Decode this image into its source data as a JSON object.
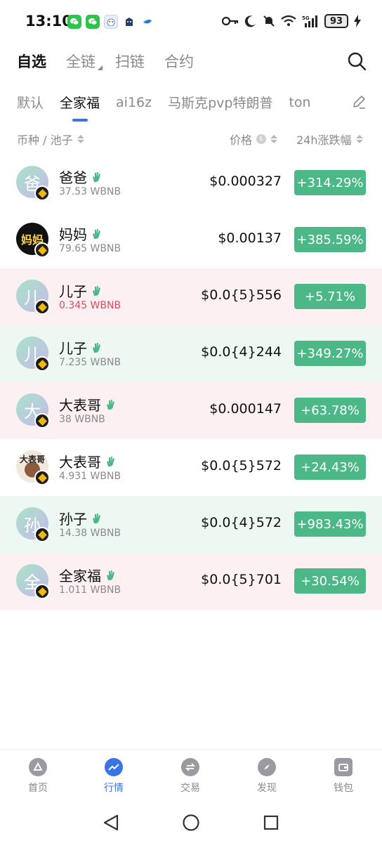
{
  "status_bar": {
    "time": "13:10",
    "battery": "93",
    "network": "5G"
  },
  "top_tabs": [
    {
      "label": "自选",
      "active": true
    },
    {
      "label": "全链",
      "active": false
    },
    {
      "label": "扫链",
      "active": false
    },
    {
      "label": "合约",
      "active": false
    }
  ],
  "sub_tabs": [
    {
      "label": "默认",
      "active": false
    },
    {
      "label": "全家福",
      "active": true
    },
    {
      "label": "ai16z",
      "active": false
    },
    {
      "label": "马斯克pvp特朗普",
      "active": false
    },
    {
      "label": "ton",
      "active": false
    }
  ],
  "columns": {
    "token": "币种 / 池子",
    "price": "价格",
    "change": "24h涨跌幅"
  },
  "tokens": [
    {
      "avatar": "爸",
      "name": "爸爸",
      "liquidity": "37.53 WBNB",
      "price": "$0.000327",
      "change": "+314.29%",
      "row_style": "plain",
      "liq_warn": false
    },
    {
      "avatar": "妈妈",
      "name": "妈妈",
      "liquidity": "79.65 WBNB",
      "price": "$0.00137",
      "change": "+385.59%",
      "row_style": "plain",
      "liq_warn": false
    },
    {
      "avatar": "儿",
      "name": "儿子",
      "liquidity": "0.345 WBNB",
      "price": "$0.0{5}556",
      "change": "+5.71%",
      "row_style": "pink",
      "liq_warn": true
    },
    {
      "avatar": "儿",
      "name": "儿子",
      "liquidity": "7.235 WBNB",
      "price": "$0.0{4}244",
      "change": "+349.27%",
      "row_style": "mint",
      "liq_warn": false
    },
    {
      "avatar": "大",
      "name": "大表哥",
      "liquidity": "38 WBNB",
      "price": "$0.000147",
      "change": "+63.78%",
      "row_style": "pink",
      "liq_warn": false
    },
    {
      "avatar": "大表哥",
      "name": "大表哥",
      "liquidity": "4.931 WBNB",
      "price": "$0.0{5}572",
      "change": "+24.43%",
      "row_style": "plain",
      "liq_warn": false
    },
    {
      "avatar": "孙",
      "name": "孙子",
      "liquidity": "14.38 WBNB",
      "price": "$0.0{4}572",
      "change": "+983.43%",
      "row_style": "mint",
      "liq_warn": false
    },
    {
      "avatar": "全",
      "name": "全家福",
      "liquidity": "1.011 WBNB",
      "price": "$0.0{5}701",
      "change": "+30.54%",
      "row_style": "pink",
      "liq_warn": false
    }
  ],
  "bottom_nav": [
    {
      "label": "首页",
      "icon": "home-icon",
      "active": false
    },
    {
      "label": "行情",
      "icon": "market-chart-icon",
      "active": true
    },
    {
      "label": "交易",
      "icon": "swap-icon",
      "active": false
    },
    {
      "label": "发现",
      "icon": "compass-icon",
      "active": false
    },
    {
      "label": "钱包",
      "icon": "wallet-icon",
      "active": false
    }
  ],
  "colors": {
    "accent": "#3a74e2",
    "gain": "#4db887",
    "warn": "#d94b5f",
    "row_pink": "#fdf0f2",
    "row_mint": "#eef8f3"
  }
}
